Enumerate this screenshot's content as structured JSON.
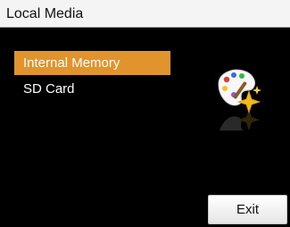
{
  "header": {
    "title": "Local Media"
  },
  "menu": {
    "items": [
      {
        "label": "Internal Memory",
        "selected": true
      },
      {
        "label": "SD Card",
        "selected": false
      }
    ]
  },
  "icon": {
    "name": "palette-sparkle-icon"
  },
  "footer": {
    "exit_label": "Exit"
  },
  "colors": {
    "background": "#000000",
    "title_bar": "#f4f4f4",
    "selection": "#e2942c",
    "menu_text": "#ffffff"
  }
}
